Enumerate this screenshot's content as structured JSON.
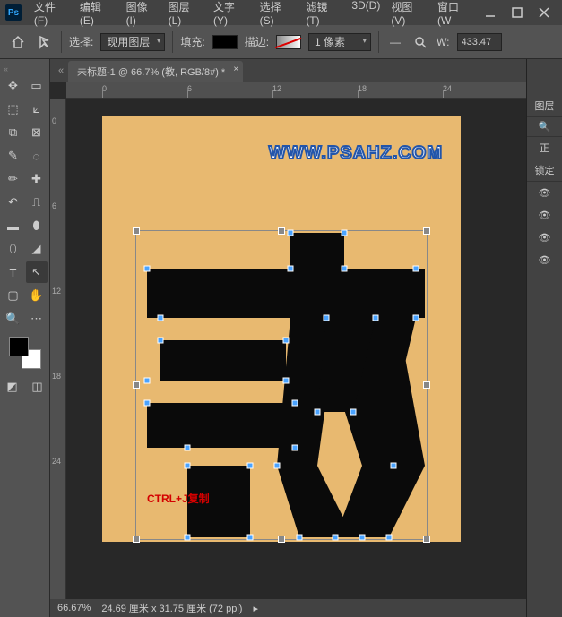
{
  "app_icon_text": "Ps",
  "menu": [
    "文件(F)",
    "编辑(E)",
    "图像(I)",
    "图层(L)",
    "文字(Y)",
    "选择(S)",
    "滤镜(T)",
    "3D(D)",
    "视图(V)",
    "窗口(W"
  ],
  "options": {
    "select_label": "选择:",
    "select_value": "现用图层",
    "fill_label": "填充:",
    "stroke_label": "描边:",
    "stroke_size": "1 像素",
    "w_label": "W:",
    "w_value": "433.47"
  },
  "doc_tab": "未标题-1 @ 66.7% (教, RGB/8#) *",
  "ruler_marks_h": [
    "0",
    "6",
    "12",
    "18",
    "24"
  ],
  "ruler_marks_v": [
    "0",
    "6",
    "12",
    "18",
    "24"
  ],
  "canvas": {
    "watermark": "WWW.PSAHZ.COM",
    "annotation": "CTRL+J复制"
  },
  "side": {
    "panel_label": "图层",
    "search_icon": "🔍",
    "mode": "正",
    "lock_label": "锁定"
  },
  "status": {
    "zoom": "66.67%",
    "doc_size": "24.69 厘米 x 31.75 厘米 (72 ppi)"
  }
}
